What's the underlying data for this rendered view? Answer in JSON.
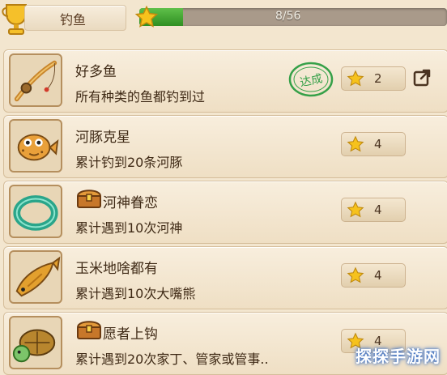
{
  "header": {
    "category_label": "钓鱼",
    "progress_text": "8/56",
    "progress_value": 0.143
  },
  "achievements": [
    {
      "title": "好多鱼",
      "desc": "所有种类的鱼都钓到过",
      "reward": "2",
      "completed": true,
      "stamp": "达成",
      "chest": false,
      "icon": "fishing-rod-icon"
    },
    {
      "title": "河豚克星",
      "desc": "累计钓到20条河豚",
      "reward": "4",
      "completed": false,
      "chest": false,
      "icon": "pufferfish-icon"
    },
    {
      "title": "河神眷恋",
      "desc": "累计遇到10次河神",
      "reward": "4",
      "completed": false,
      "chest": true,
      "icon": "jade-ring-icon"
    },
    {
      "title": "玉米地啥都有",
      "desc": "累计遇到10次大嘴熊",
      "reward": "4",
      "completed": false,
      "chest": false,
      "icon": "golden-fish-icon"
    },
    {
      "title": "愿者上钩",
      "desc": "累计遇到20次家丁、管家或管事..",
      "reward": "4",
      "completed": false,
      "chest": true,
      "icon": "turtle-icon"
    }
  ],
  "watermark": "探探手游网",
  "colors": {
    "accent_green": "#3fa02e",
    "star": "#f6c21c",
    "stamp_green": "#35a048"
  }
}
